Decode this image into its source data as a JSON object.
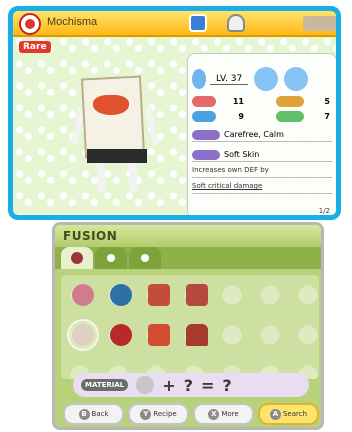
{
  "top": {
    "name": "Mochisma",
    "badge": "Rare",
    "colors": {
      "frame": "#19aee6",
      "title": "#ffb816",
      "badge": "#e3382b"
    },
    "stats": {
      "level": "LV. 37",
      "values": [
        {
          "label": "",
          "value": "11"
        },
        {
          "label": "",
          "value": "5"
        },
        {
          "label": "",
          "value": "9"
        },
        {
          "label": "",
          "value": "7"
        }
      ],
      "attitude": "Carefree, Calm",
      "skill": "Soft Skin",
      "desc1": "Increases own DEF by",
      "desc2": "Soft critical damage",
      "page": "1/2"
    }
  },
  "bottom": {
    "title": "FUSION",
    "tabs": [
      "",
      "",
      ""
    ],
    "fuse": {
      "material": "MATERIAL",
      "plus": "+",
      "q1": "?",
      "eq": "=",
      "q2": "?"
    },
    "buttons": [
      {
        "key": "B",
        "label": "Back"
      },
      {
        "key": "Y",
        "label": "Recipe"
      },
      {
        "key": "X",
        "label": "More"
      },
      {
        "key": "A",
        "label": "Search"
      }
    ]
  }
}
